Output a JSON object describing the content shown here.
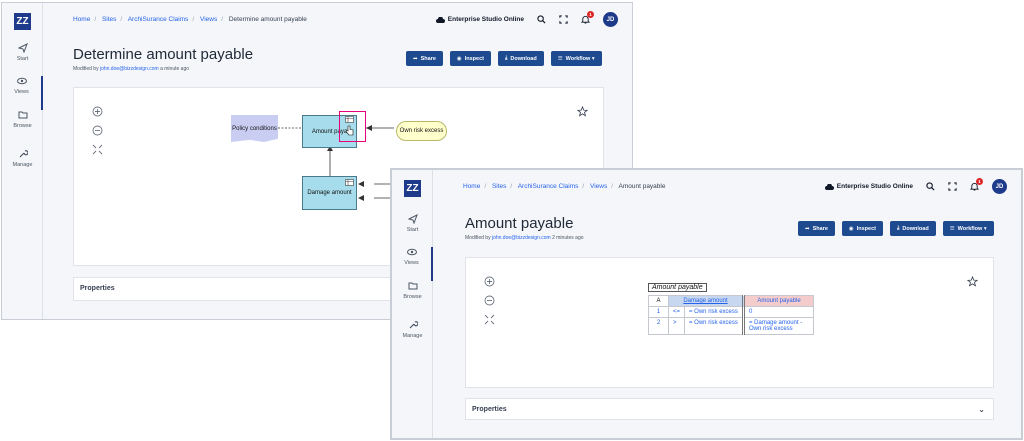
{
  "window1": {
    "logo": "ZZ",
    "nav": [
      {
        "label": "Start",
        "icon": "send-icon"
      },
      {
        "label": "Views",
        "icon": "eye-icon"
      },
      {
        "label": "Browse",
        "icon": "folder-icon"
      },
      {
        "label": "Manage",
        "icon": "wrench-icon"
      }
    ],
    "breadcrumb": [
      "Home",
      "Sites",
      "ArchiSurance Claims",
      "Views",
      "Determine amount payable"
    ],
    "org": "Enterprise Studio Online",
    "notif_count": "1",
    "avatar": "JD",
    "title": "Determine amount payable",
    "modified_prefix": "Modified by",
    "modified_user": "john.doe@bizzdesign.com",
    "modified_time": "a minute ago",
    "actions": [
      "Share",
      "Inspect",
      "Download",
      "Workflow ▾"
    ],
    "diagram": {
      "policy": "Policy conditions",
      "amount": "Amount paya",
      "risk": "Own risk excess",
      "damage": "Damage amount"
    },
    "properties": "Properties"
  },
  "window2": {
    "logo": "ZZ",
    "nav": [
      {
        "label": "Start",
        "icon": "send-icon"
      },
      {
        "label": "Views",
        "icon": "eye-icon"
      },
      {
        "label": "Browse",
        "icon": "folder-icon"
      },
      {
        "label": "Manage",
        "icon": "wrench-icon"
      }
    ],
    "breadcrumb": [
      "Home",
      "Sites",
      "ArchiSurance Claims",
      "Views",
      "Amount payable"
    ],
    "org": "Enterprise Studio Online",
    "notif_count": "1",
    "avatar": "JD",
    "title": "Amount payable",
    "modified_prefix": "Modified by",
    "modified_user": "john.doe@bizzdesign.com",
    "modified_time": "2 minutes ago",
    "actions": [
      "Share",
      "Inspect",
      "Download",
      "Workflow ▾"
    ],
    "table": {
      "title": "Amount payable",
      "hit_policy": "A",
      "input_header": "Damage amount",
      "output_header": "Amount payable",
      "rows": [
        {
          "num": "1",
          "op": "<=",
          "input": "= Own risk excess",
          "output": "0"
        },
        {
          "num": "2",
          "op": ">",
          "input": "= Own risk excess",
          "output": "= Damage amount - Own risk excess"
        }
      ]
    },
    "properties": "Properties"
  }
}
